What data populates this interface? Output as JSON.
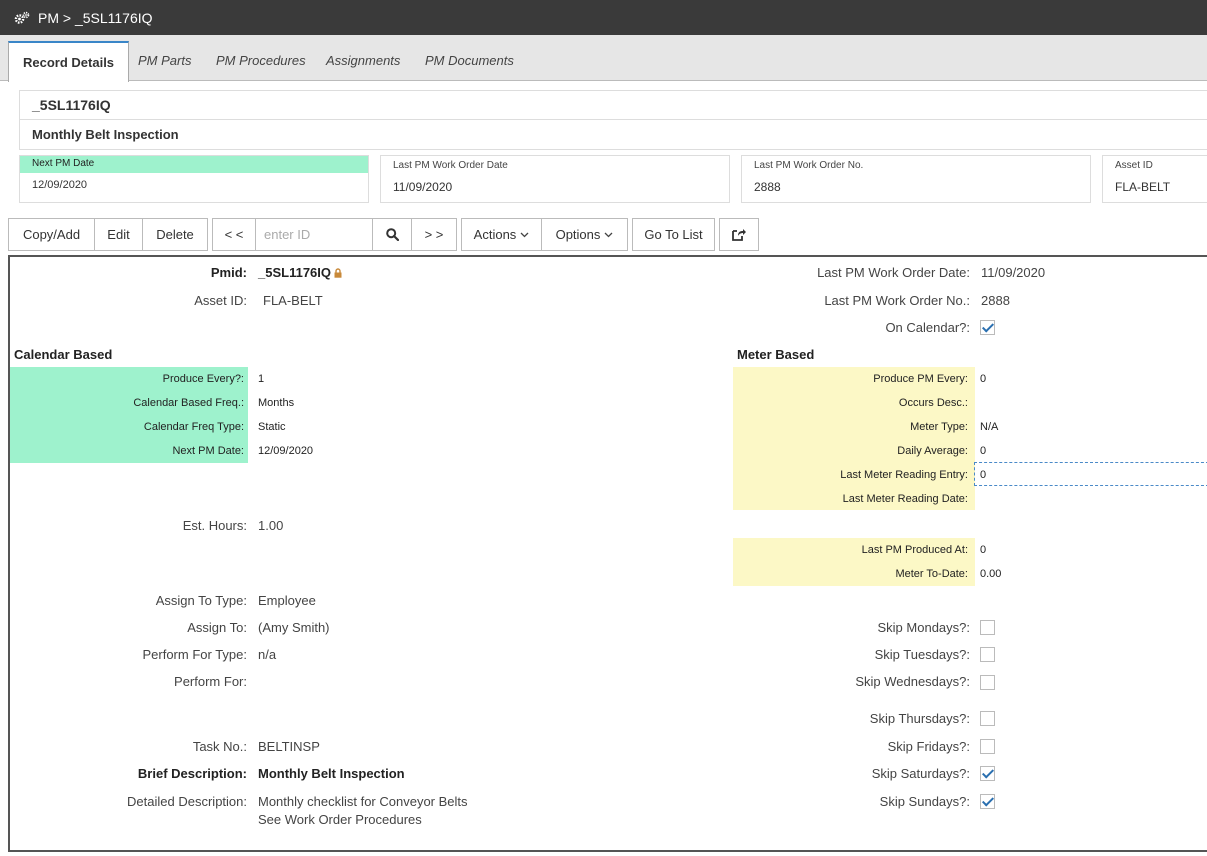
{
  "header": {
    "title": "PM > _5SL1176IQ"
  },
  "tabs": [
    "Record Details",
    "PM Parts",
    "PM Procedures",
    "Assignments",
    "PM Documents"
  ],
  "record": {
    "id": "_5SL1176IQ",
    "description": "Monthly Belt Inspection"
  },
  "info": {
    "next_pm_date_label": "Next PM Date",
    "next_pm_date": "12/09/2020",
    "last_wo_date_label": "Last PM Work Order Date",
    "last_wo_date": "11/09/2020",
    "last_wo_no_label": "Last PM Work Order No.",
    "last_wo_no": "2888",
    "asset_id_label": "Asset ID",
    "asset_id": "FLA-BELT"
  },
  "toolbar": {
    "copy_add": "Copy/Add",
    "edit": "Edit",
    "delete": "Delete",
    "prev": "< <",
    "search_placeholder": "enter ID",
    "next": "> >",
    "actions": "Actions",
    "options": "Options",
    "go_to_list": "Go To List"
  },
  "detail": {
    "pmid_label": "Pmid:",
    "pmid": "_5SL1176IQ",
    "asset_label": "Asset ID:",
    "asset": "FLA-BELT",
    "last_wo_date_label": "Last PM Work Order Date:",
    "last_wo_date": "11/09/2020",
    "last_wo_no_label": "Last PM Work Order No.:",
    "last_wo_no": "2888",
    "on_calendar_label": "On Calendar?:",
    "on_calendar": true,
    "calendar_section": "Calendar Based",
    "meter_section": "Meter Based",
    "produce_every_label": "Produce Every?:",
    "produce_every": "1",
    "cal_freq_label": "Calendar Based Freq.:",
    "cal_freq": "Months",
    "cal_freq_type_label": "Calendar Freq Type:",
    "cal_freq_type": "Static",
    "next_pm_label": "Next PM Date:",
    "next_pm": "12/09/2020",
    "produce_pm_every_label": "Produce PM Every:",
    "produce_pm_every": "0",
    "occurs_desc_label": "Occurs Desc.:",
    "occurs_desc": "",
    "meter_type_label": "Meter Type:",
    "meter_type": "N/A",
    "daily_avg_label": "Daily Average:",
    "daily_avg": "0",
    "last_meter_entry_label": "Last Meter Reading Entry:",
    "last_meter_entry": "0",
    "last_meter_date_label": "Last Meter Reading Date:",
    "last_meter_date": "",
    "est_hours_label": "Est. Hours:",
    "est_hours": "1.00",
    "last_pm_produced_label": "Last PM Produced At:",
    "last_pm_produced": "0",
    "meter_to_date_label": "Meter To-Date:",
    "meter_to_date": "0.00",
    "assign_type_label": "Assign To Type:",
    "assign_type": "Employee",
    "assign_to_label": "Assign To:",
    "assign_to": "(Amy Smith)",
    "perform_type_label": "Perform For Type:",
    "perform_type": "n/a",
    "perform_for_label": "Perform For:",
    "perform_for": "",
    "task_no_label": "Task No.:",
    "task_no": "BELTINSP",
    "brief_desc_label": "Brief Description:",
    "brief_desc": "Monthly Belt Inspection",
    "detailed_desc_label": "Detailed Description:",
    "detailed_desc_line1": "Monthly checklist for Conveyor Belts",
    "detailed_desc_line2": "See Work Order Procedures",
    "skip_mon_label": "Skip Mondays?:",
    "skip_tue_label": "Skip Tuesdays?:",
    "skip_wed_label": "Skip Wednesdays?:",
    "skip_thu_label": "Skip Thursdays?:",
    "skip_fri_label": "Skip Fridays?:",
    "skip_sat_label": "Skip Saturdays?:",
    "skip_sun_label": "Skip Sundays?:",
    "skip_mon": false,
    "skip_tue": false,
    "skip_wed": false,
    "skip_thu": false,
    "skip_fri": false,
    "skip_sat": true,
    "skip_sun": true
  }
}
